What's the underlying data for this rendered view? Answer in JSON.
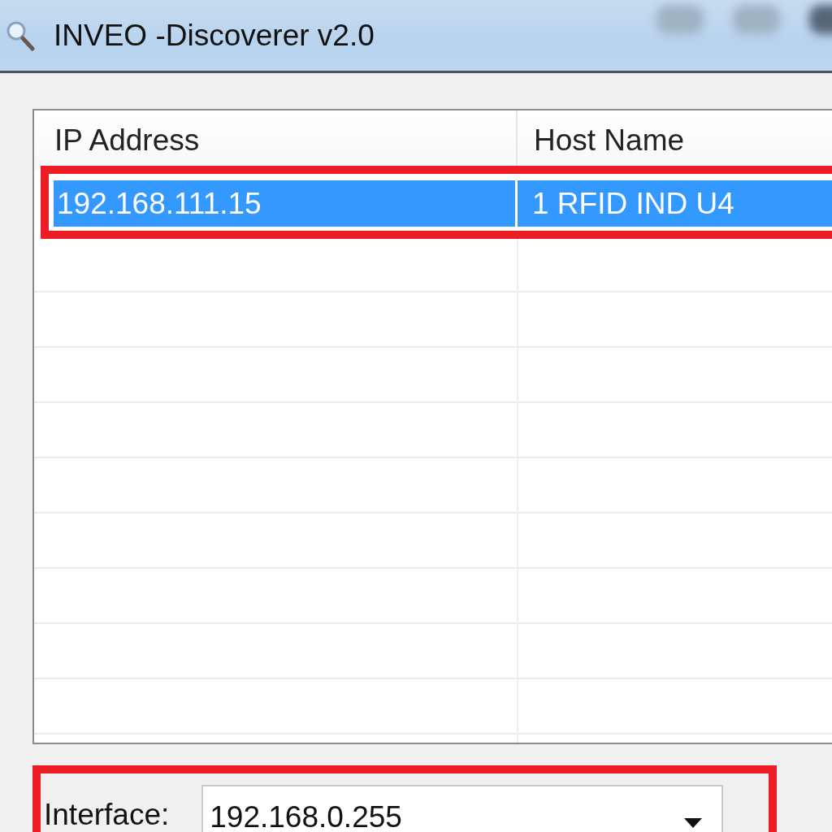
{
  "window": {
    "title": "INVEO -Discoverer v2.0"
  },
  "table": {
    "columns": [
      "IP Address",
      "Host Name"
    ],
    "rows": [
      {
        "cells": [
          "192.168.111.15",
          "1 RFID IND U4"
        ],
        "selected": true,
        "highlighted": true
      }
    ]
  },
  "interface": {
    "label": "Interface:",
    "value": "192.168.0.255",
    "highlighted": true
  }
}
